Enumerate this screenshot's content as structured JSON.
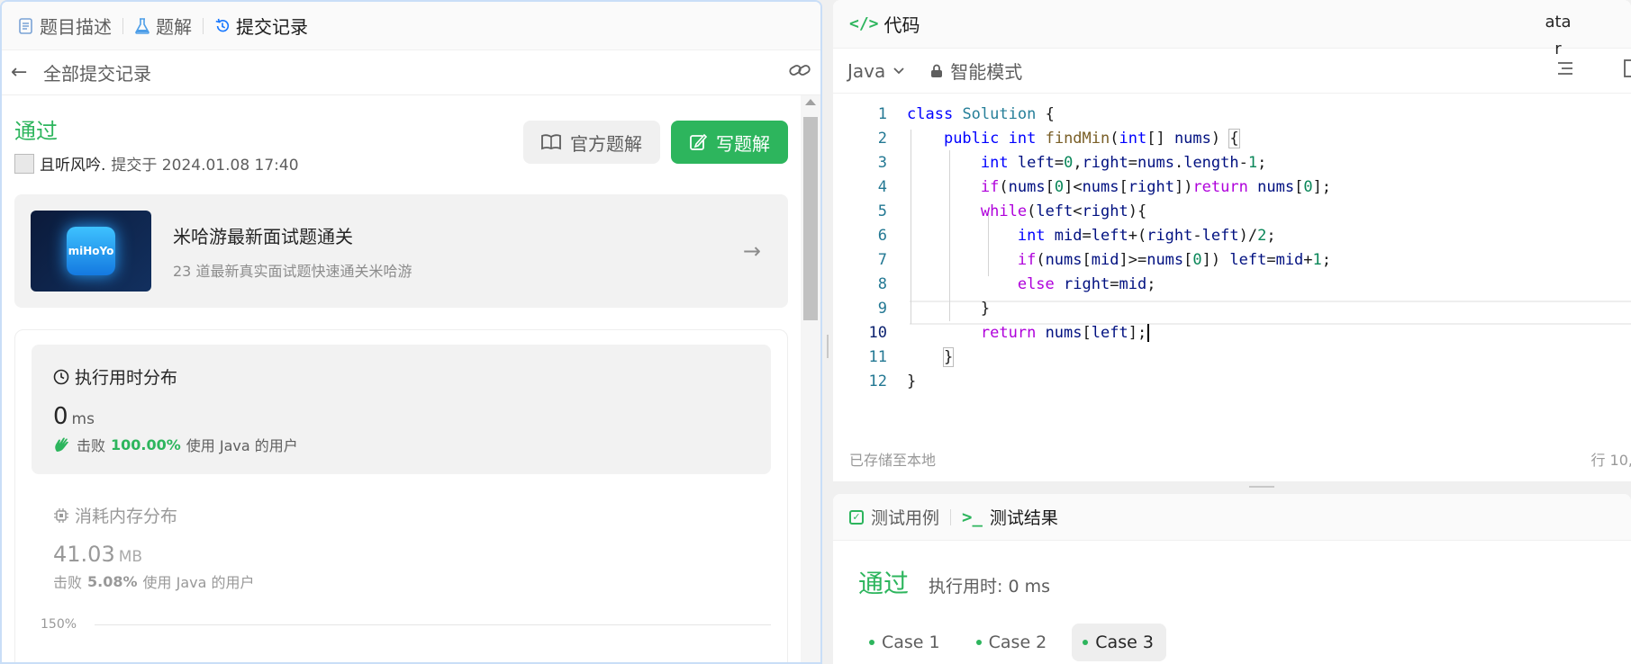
{
  "left_panel": {
    "tabs": [
      {
        "label": "题目描述",
        "icon": "document-icon"
      },
      {
        "label": "题解",
        "icon": "flask-icon"
      },
      {
        "label": "提交记录",
        "icon": "history-icon"
      }
    ],
    "subheader": {
      "title": "全部提交记录"
    },
    "submission": {
      "status": "通过",
      "user": "且听风吟.",
      "submitted_text": "提交于 2024.01.08 17:40",
      "btn_official": "官方题解",
      "btn_write": "写题解"
    },
    "promo": {
      "logo_text": "miHoYo",
      "title": "米哈游最新面试题通关",
      "desc": "23 道最新真实面试题快速通关米哈游"
    },
    "runtime": {
      "title": "执行用时分布",
      "value": "0",
      "unit": "ms",
      "beats_prefix": "击败",
      "beats_pct": "100.00%",
      "beats_suffix": "使用 Java 的用户"
    },
    "memory": {
      "title": "消耗内存分布",
      "value": "41.03",
      "unit": "MB",
      "beats_prefix": "击败",
      "beats_pct": "5.08%",
      "beats_suffix": "使用 Java 的用户"
    },
    "axis_tick": "150%"
  },
  "code_panel": {
    "tab_label": "代码",
    "tooltip_fragment_1": "ata",
    "tooltip_fragment_2": "r",
    "language": "Java",
    "mode": "智能模式",
    "saved_text": "已存储至本地",
    "position_text": "行 10,",
    "lines": [
      "1",
      "2",
      "3",
      "4",
      "5",
      "6",
      "7",
      "8",
      "9",
      "10",
      "11",
      "12"
    ]
  },
  "test_panel": {
    "tab_cases": "测试用例",
    "tab_results": "测试结果",
    "status": "通过",
    "runtime": "执行用时: 0 ms",
    "cases": [
      "Case 1",
      "Case 2",
      "Case 3"
    ],
    "active_case": "Case 3"
  },
  "colors": {
    "accent_green": "#2db55d",
    "keyword_blue": "#0000ff",
    "keyword_purple": "#af00db"
  }
}
